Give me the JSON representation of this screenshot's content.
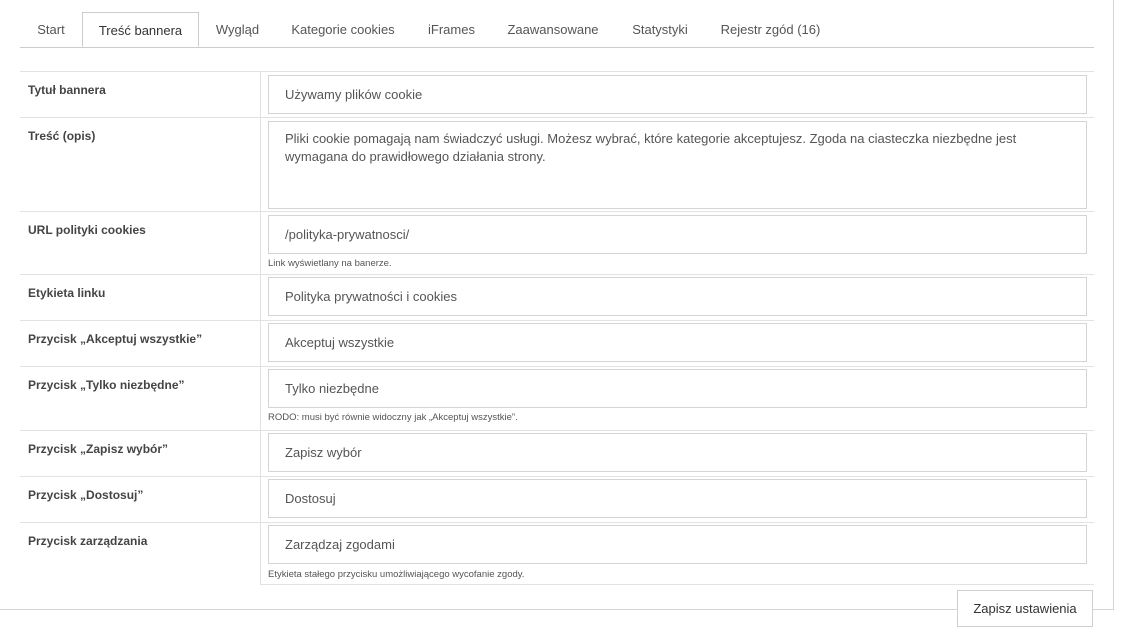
{
  "tabs": [
    {
      "label": "Start"
    },
    {
      "label": "Treść bannera"
    },
    {
      "label": "Wygląd"
    },
    {
      "label": "Kategorie cookies"
    },
    {
      "label": "iFrames"
    },
    {
      "label": "Zaawansowane"
    },
    {
      "label": "Statystyki"
    },
    {
      "label": "Rejestr zgód (16)"
    }
  ],
  "active_tab": "Treść bannera",
  "fields": {
    "banner_title": {
      "label": "Tytuł bannera",
      "value": "Używamy plików cookie"
    },
    "description": {
      "label": "Treść (opis)",
      "value": "Pliki cookie pomagają nam świadczyć usługi. Możesz wybrać, które kategorie akceptujesz. Zgoda na ciasteczka niezbędne jest wymagana do prawidłowego działania strony."
    },
    "policy_url": {
      "label": "URL polityki cookies",
      "value": "/polityka-prywatnosci/",
      "hint": "Link wyświetlany na banerze."
    },
    "link_label": {
      "label": "Etykieta linku",
      "value": "Polityka prywatności i cookies"
    },
    "accept_all": {
      "label": "Przycisk „Akceptuj wszystkie”",
      "value": "Akceptuj wszystkie"
    },
    "only_necessary": {
      "label": "Przycisk „Tylko niezbędne”",
      "value": "Tylko niezbędne",
      "hint": "RODO: musi być równie widoczny jak „Akceptuj wszystkie”."
    },
    "save_choice": {
      "label": "Przycisk „Zapisz wybór”",
      "value": "Zapisz wybór"
    },
    "customize": {
      "label": "Przycisk „Dostosuj”",
      "value": "Dostosuj"
    },
    "manage": {
      "label": "Przycisk zarządzania",
      "value": "Zarządzaj zgodami",
      "hint": "Etykieta stałego przycisku umożliwiającego wycofanie zgody."
    }
  },
  "save_button": "Zapisz ustawienia"
}
